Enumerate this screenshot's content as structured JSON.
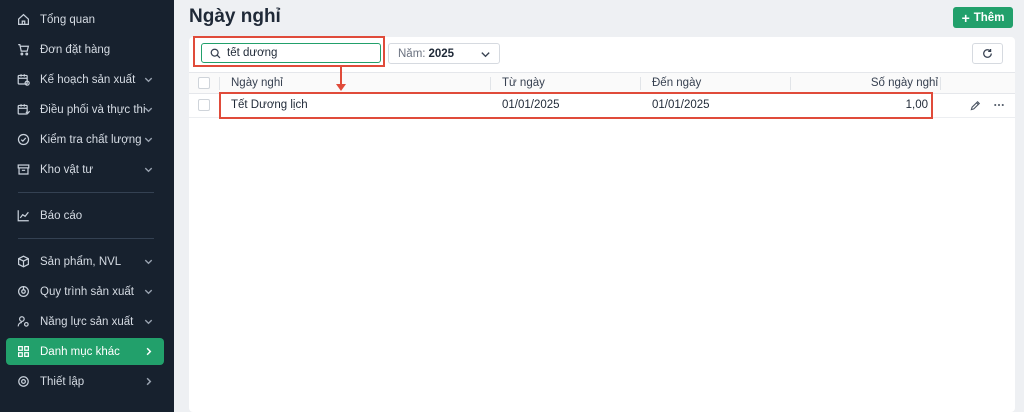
{
  "sidebar": {
    "items": [
      {
        "label": "Tổng quan",
        "icon": "home-icon",
        "chevron": false,
        "active": false
      },
      {
        "label": "Đơn đặt hàng",
        "icon": "cart-icon",
        "chevron": false,
        "active": false
      },
      {
        "label": "Kế hoạch sản xuất",
        "icon": "calendar-plan-icon",
        "chevron": true,
        "active": false
      },
      {
        "label": "Điều phối và thực thi",
        "icon": "calendar-execute-icon",
        "chevron": true,
        "active": false
      },
      {
        "label": "Kiểm tra chất lượng",
        "icon": "quality-check-icon",
        "chevron": true,
        "active": false
      },
      {
        "label": "Kho vật tư",
        "icon": "warehouse-icon",
        "chevron": true,
        "active": false
      },
      {
        "label": "Báo cáo",
        "icon": "report-chart-icon",
        "chevron": false,
        "active": false
      },
      {
        "label": "Sản phẩm, NVL",
        "icon": "box-icon",
        "chevron": true,
        "active": false
      },
      {
        "label": "Quy trình sản xuất",
        "icon": "process-icon",
        "chevron": true,
        "active": false
      },
      {
        "label": "Năng lực sản xuất",
        "icon": "capacity-icon",
        "chevron": true,
        "active": false
      },
      {
        "label": "Danh mục khác",
        "icon": "grid-icon",
        "chevron": true,
        "active": true
      },
      {
        "label": "Thiết lập",
        "icon": "gear-icon",
        "chevron": true,
        "active": false
      }
    ]
  },
  "header": {
    "title": "Ngày nghỉ",
    "add_label": "Thêm"
  },
  "toolbar": {
    "search_value": "tết dương",
    "year_label": "Năm:",
    "year_value": "2025"
  },
  "table": {
    "columns": [
      "Ngày nghỉ",
      "Từ ngày",
      "Đến ngày",
      "Số ngày nghỉ"
    ],
    "rows": [
      {
        "name": "Tết Dương lịch",
        "from": "01/01/2025",
        "to": "01/01/2025",
        "days": "1,00"
      }
    ]
  },
  "colors": {
    "accent": "#22a06b",
    "sidebar_bg": "#17212e",
    "annotation": "#e04b3a"
  }
}
